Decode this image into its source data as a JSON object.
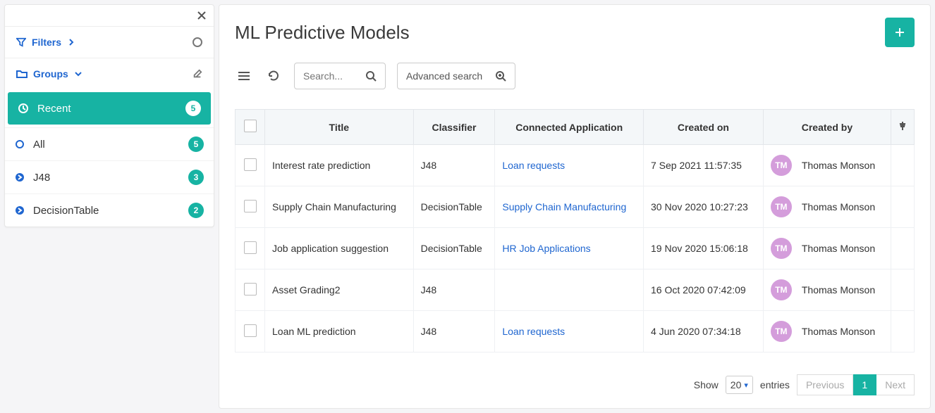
{
  "sidebar": {
    "filters_label": "Filters",
    "groups_label": "Groups",
    "items": [
      {
        "label": "Recent",
        "count": "5"
      },
      {
        "label": "All",
        "count": "5"
      },
      {
        "label": "J48",
        "count": "3"
      },
      {
        "label": "DecisionTable",
        "count": "2"
      }
    ]
  },
  "header": {
    "title": "ML Predictive Models"
  },
  "toolbar": {
    "search_placeholder": "Search...",
    "advanced_label": "Advanced search"
  },
  "table": {
    "columns": {
      "title": "Title",
      "classifier": "Classifier",
      "connected": "Connected Application",
      "created_on": "Created on",
      "created_by": "Created by"
    },
    "rows": [
      {
        "title": "Interest rate prediction",
        "classifier": "J48",
        "connected": "Loan requests",
        "created_on": "7 Sep 2021 11:57:35",
        "created_by": "Thomas Monson",
        "initials": "TM"
      },
      {
        "title": "Supply Chain Manufacturing",
        "classifier": "DecisionTable",
        "connected": "Supply Chain Manufacturing",
        "created_on": "30 Nov 2020 10:27:23",
        "created_by": "Thomas Monson",
        "initials": "TM"
      },
      {
        "title": "Job application suggestion",
        "classifier": "DecisionTable",
        "connected": "HR Job Applications",
        "created_on": "19 Nov 2020 15:06:18",
        "created_by": "Thomas Monson",
        "initials": "TM"
      },
      {
        "title": "Asset Grading2",
        "classifier": "J48",
        "connected": "",
        "created_on": "16 Oct 2020 07:42:09",
        "created_by": "Thomas Monson",
        "initials": "TM"
      },
      {
        "title": "Loan ML prediction",
        "classifier": "J48",
        "connected": "Loan requests",
        "created_on": "4 Jun 2020 07:34:18",
        "created_by": "Thomas Monson",
        "initials": "TM"
      }
    ]
  },
  "footer": {
    "show_label": "Show",
    "page_size": "20",
    "entries_label": "entries",
    "previous_label": "Previous",
    "page_number": "1",
    "next_label": "Next"
  }
}
